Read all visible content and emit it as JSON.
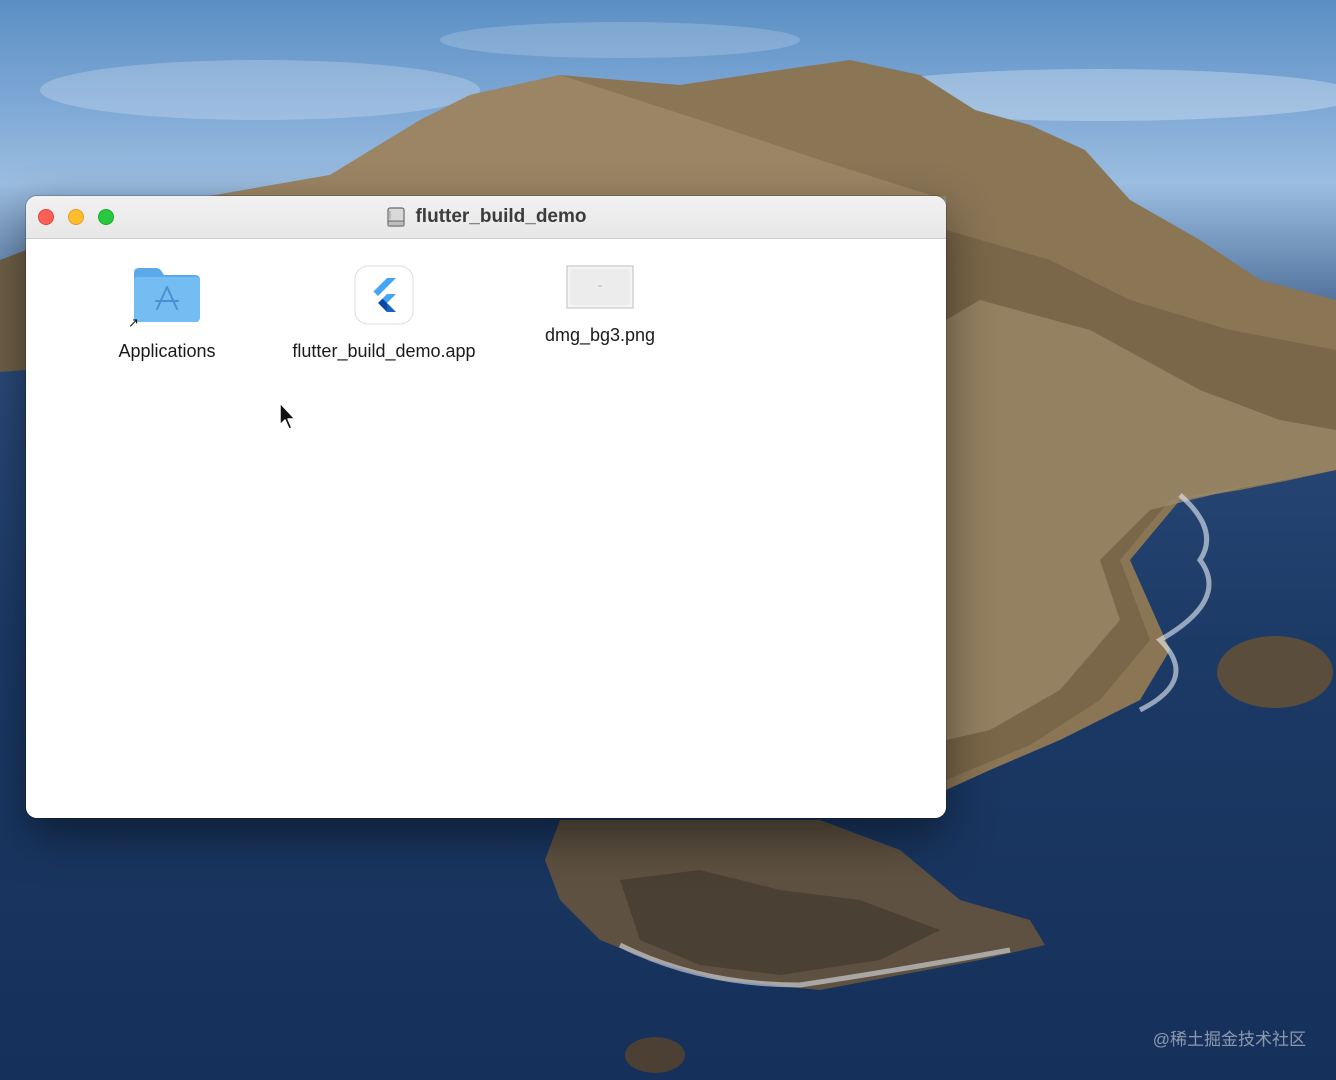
{
  "window": {
    "title": "flutter_build_demo",
    "title_icon": "disk-image-icon",
    "controls": [
      "close",
      "minimize",
      "zoom"
    ],
    "colors": {
      "close": "#fe5f57",
      "minimize": "#febc2e",
      "zoom": "#28c840"
    }
  },
  "items": [
    {
      "label": "Applications",
      "icon": "applications-folder-alias-icon"
    },
    {
      "label": "flutter_build_demo.app",
      "icon": "flutter-app-icon"
    },
    {
      "label": "dmg_bg3.png",
      "icon": "image-file-thumbnail-icon"
    }
  ],
  "watermark": "@稀土掘金技术社区"
}
